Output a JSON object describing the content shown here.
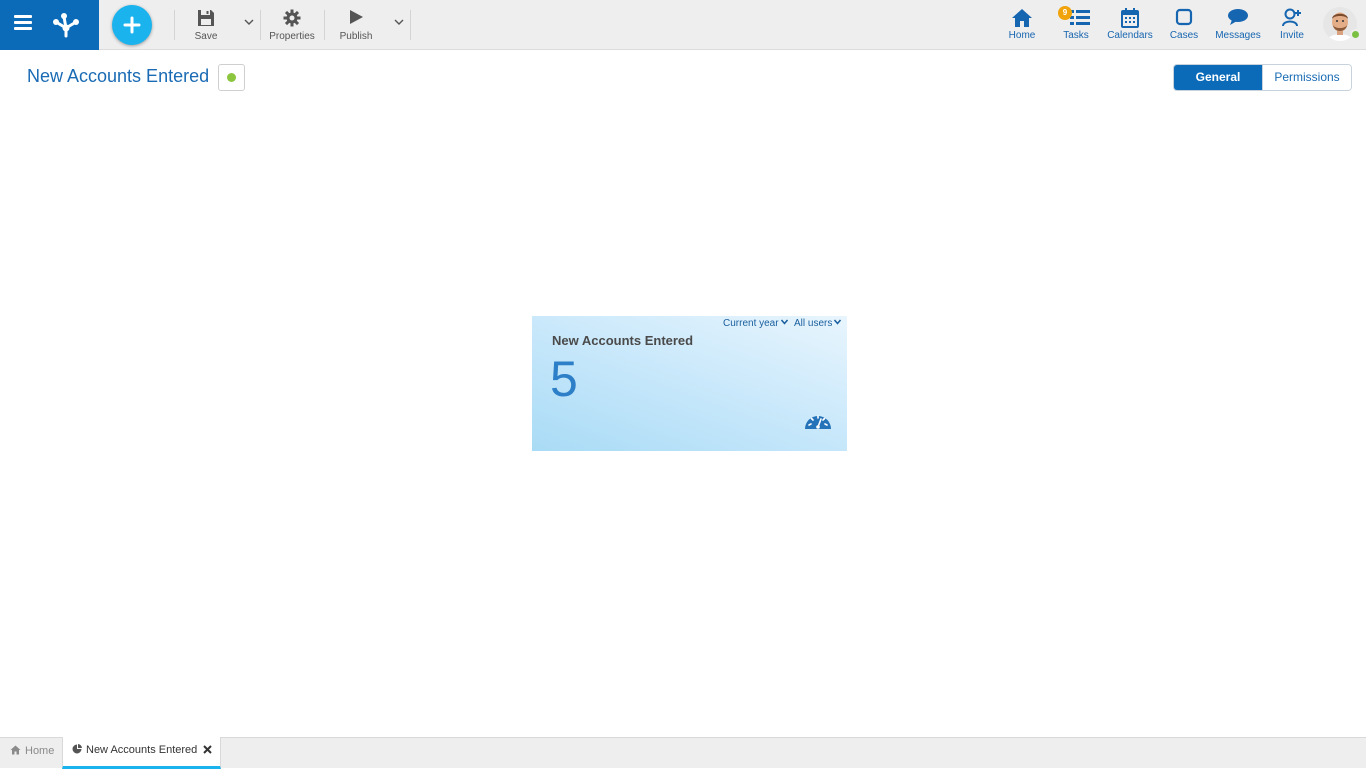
{
  "toolbar": {
    "save_label": "Save",
    "properties_label": "Properties",
    "publish_label": "Publish"
  },
  "nav": {
    "home_label": "Home",
    "tasks_label": "Tasks",
    "tasks_badge": "9",
    "calendars_label": "Calendars",
    "cases_label": "Cases",
    "messages_label": "Messages",
    "invite_label": "Invite"
  },
  "page": {
    "title": "New Accounts Entered",
    "tabs": [
      {
        "label": "General",
        "active": true
      },
      {
        "label": "Permissions",
        "active": false
      }
    ]
  },
  "indicator": {
    "period_filter": "Current year",
    "users_filter": "All users",
    "title": "New Accounts Entered",
    "value": "5"
  },
  "bottom_tabs": {
    "home_label": "Home",
    "active_label": "New Accounts Entered"
  },
  "colors": {
    "brand_blue": "#0b6bb8",
    "accent_cyan": "#1ab3ee",
    "status_green": "#8cc63f",
    "badge_orange": "#f0a30a"
  },
  "icons": {
    "menu": "hamburger-icon",
    "add": "plus-icon",
    "save": "floppy-icon",
    "properties": "gear-icon",
    "publish": "play-icon",
    "home": "house-icon",
    "tasks": "tasks-icon",
    "calendars": "calendar-icon",
    "cases": "square-icon",
    "messages": "chat-bubble-icon",
    "invite": "add-user-icon",
    "indicator": "gauge-icon"
  }
}
